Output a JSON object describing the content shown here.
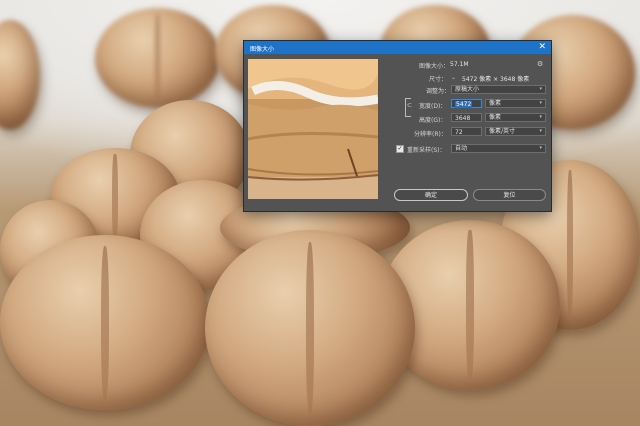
{
  "dialog": {
    "title": "图像大小",
    "close_glyph": "✕",
    "image_size_label": "图像大小：",
    "image_size_value": "57.1M",
    "dimensions_label": "尺寸：",
    "dimensions_value": "5472 像素 × 3648 像素",
    "fit_to_label": "调整为：",
    "fit_to_value": "原稿大小",
    "width_label": "宽度(D)：",
    "width_value": "5472",
    "width_unit": "像素",
    "height_label": "高度(G)：",
    "height_value": "3648",
    "height_unit": "像素",
    "resolution_label": "分辨率(R)：",
    "resolution_value": "72",
    "resolution_unit": "像素/英寸",
    "resample_label": "重新采样(S)：",
    "resample_checked": true,
    "resample_value": "自动",
    "ok_label": "确定",
    "reset_label": "复位"
  },
  "icons": {
    "close": "close-icon",
    "gear": "gear-icon",
    "link": "link-icon",
    "dimensions_dropdown": "chevron-down-icon"
  },
  "colors": {
    "titlebar": "#1e72c8",
    "dialog_bg": "#535353",
    "highlight": "#2d6fb6"
  }
}
